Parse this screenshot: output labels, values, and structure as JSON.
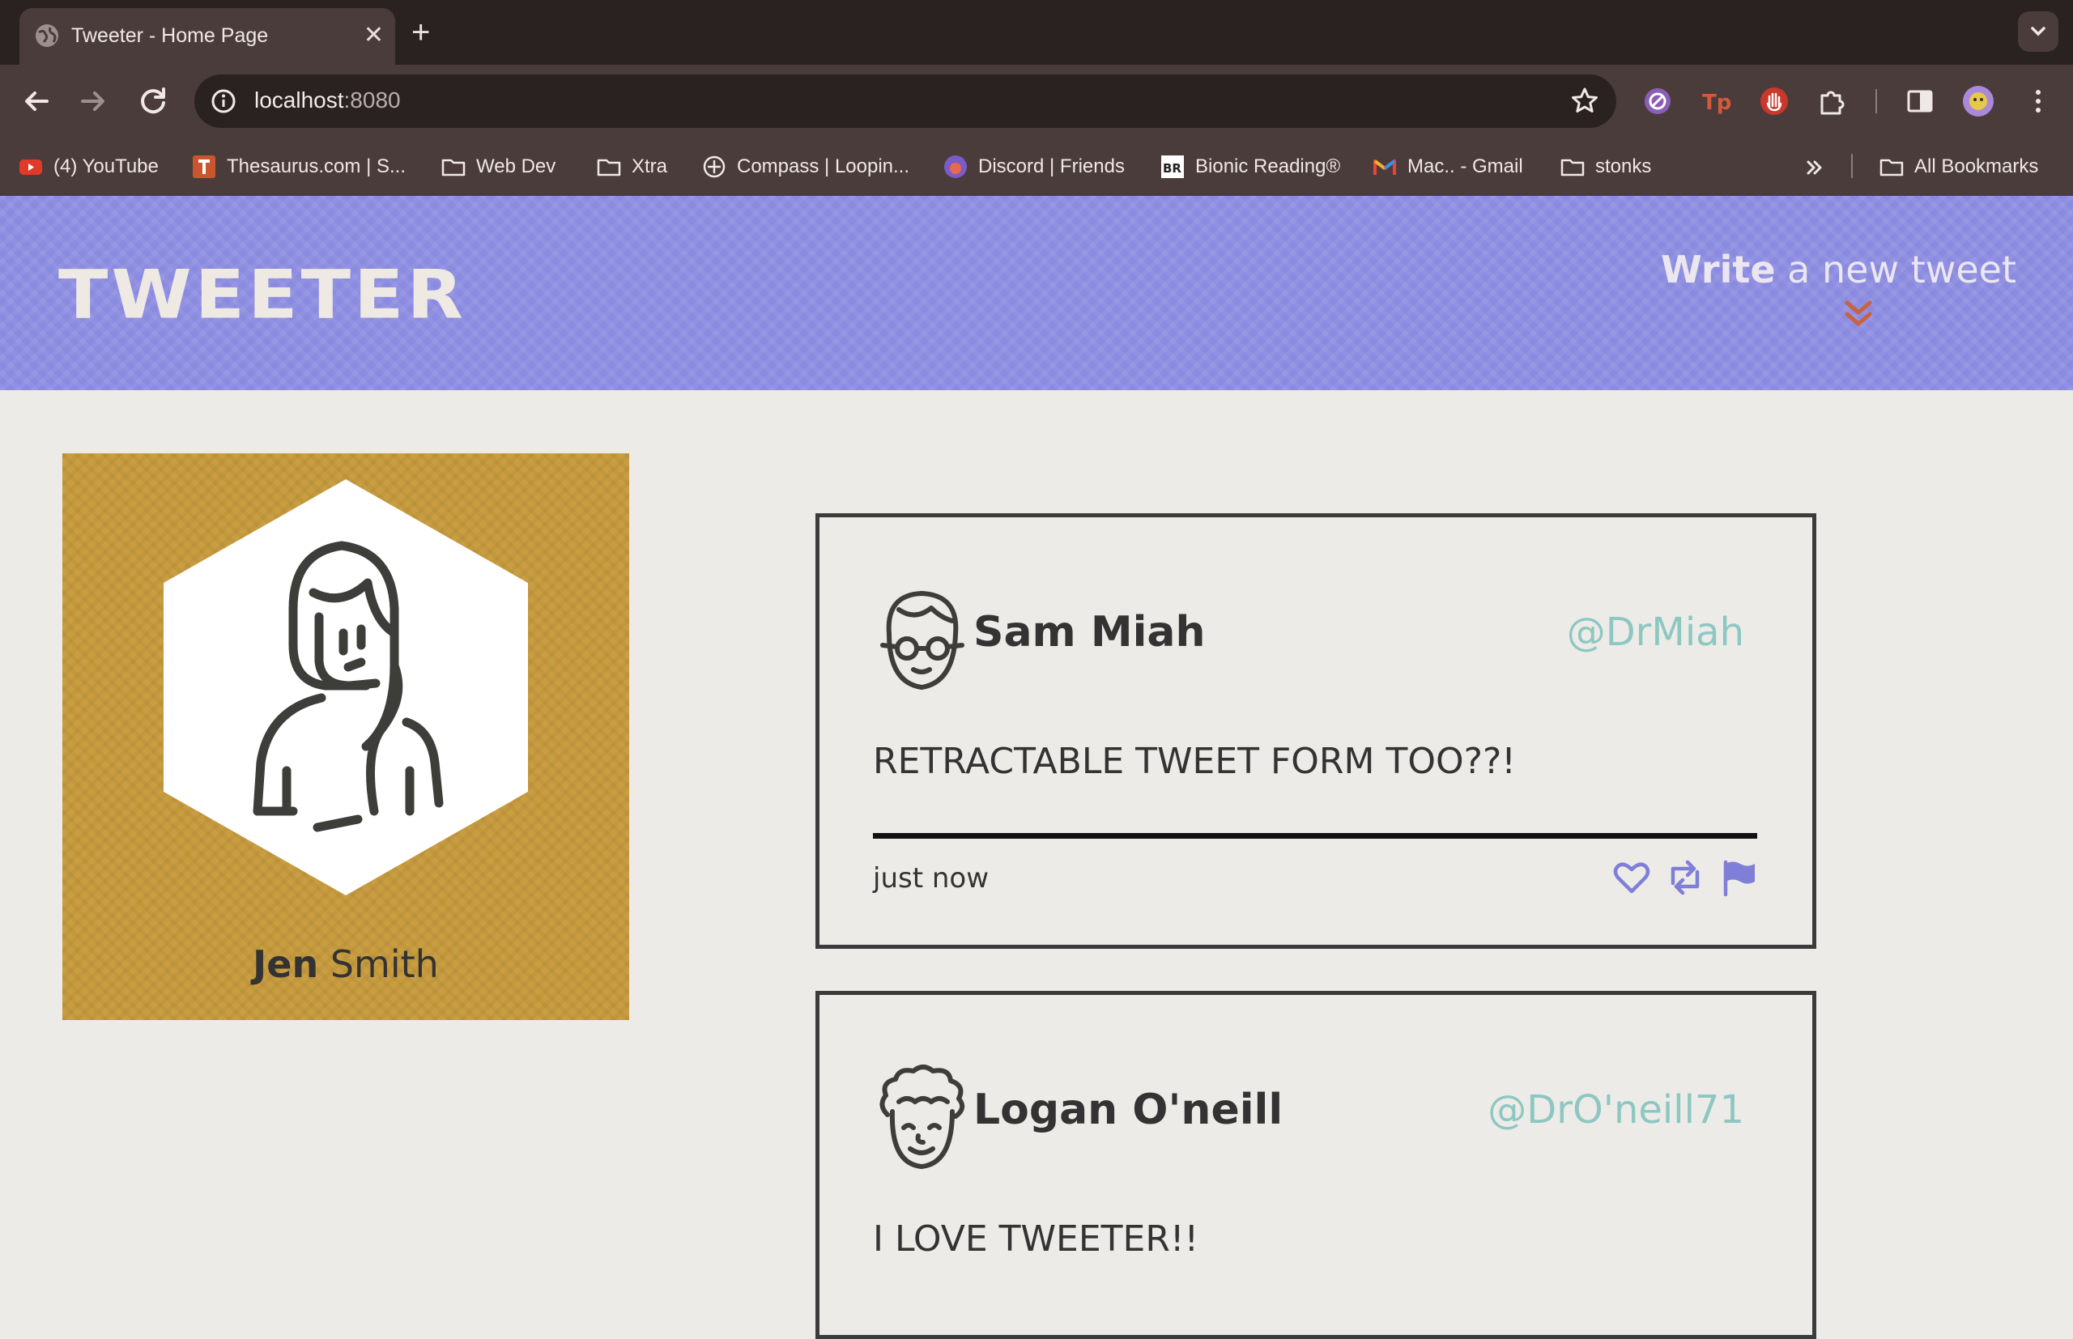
{
  "browser": {
    "tab_title": "Tweeter - Home Page",
    "close_glyph": "✕",
    "new_tab_glyph": "+",
    "url_host": "localhost",
    "url_port": ":8080"
  },
  "bookmarks": [
    {
      "label": "(4) YouTube",
      "icon": "youtube-icon"
    },
    {
      "label": "Thesaurus.com | S...",
      "icon": "thesaurus-icon"
    },
    {
      "label": "Web Dev",
      "icon": "folder-icon"
    },
    {
      "label": "Xtra",
      "icon": "folder-icon"
    },
    {
      "label": "Compass | Loopin...",
      "icon": "compass-icon"
    },
    {
      "label": "Discord | Friends",
      "icon": "discord-icon"
    },
    {
      "label": "Bionic Reading®",
      "icon": "bionic-reading-icon"
    },
    {
      "label": "Mac.. - Gmail",
      "icon": "gmail-icon"
    },
    {
      "label": "stonks",
      "icon": "folder-icon"
    },
    {
      "label": "All Bookmarks",
      "icon": "folder-icon"
    }
  ],
  "header": {
    "logo": "TWEETER",
    "write_bold": "Write",
    "write_rest": " a new tweet"
  },
  "profile": {
    "first_name": "Jen",
    "last_name": " Smith"
  },
  "tweets": [
    {
      "name": "Sam Miah",
      "handle": "@DrMiah",
      "text": "RETRACTABLE TWEET FORM TOO??!",
      "time": "just now"
    },
    {
      "name": "Logan O'neill",
      "handle": "@DrO'neill71",
      "text": "I LOVE TWEETER!!"
    }
  ],
  "colors": {
    "header_bg": "#8a8ae0",
    "profile_bg": "#c99d40",
    "handle": "#8dc7c2",
    "action_icons": "#7f7fd8",
    "chevron": "#c9623f"
  }
}
